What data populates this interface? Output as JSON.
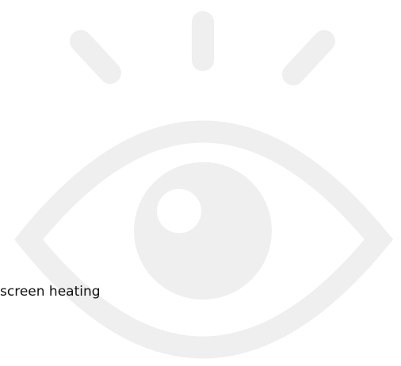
{
  "caption": {
    "text": "screen heating"
  },
  "graphic": {
    "icon": "eye-icon",
    "color": "#efefef",
    "background": "#ffffff",
    "text_color": "#111111"
  }
}
